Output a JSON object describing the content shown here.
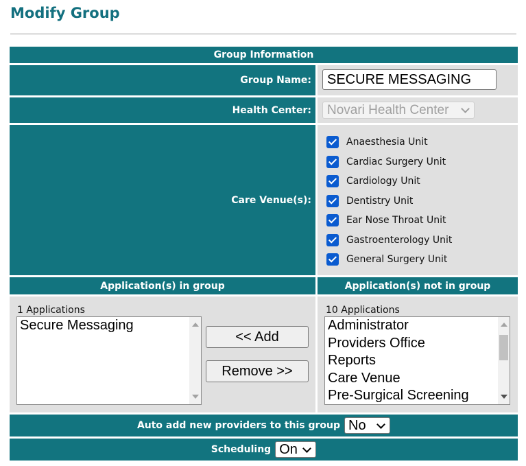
{
  "page": {
    "title": "Modify Group"
  },
  "group_info": {
    "header": "Group Information",
    "group_name_label": "Group Name:",
    "group_name_value": "SECURE MESSAGING",
    "health_center_label": "Health Center:",
    "health_center_value": "Novari Health Center",
    "care_venue_label": "Care Venue(s):",
    "care_venues": [
      {
        "label": "Anaesthesia Unit",
        "checked": true
      },
      {
        "label": "Cardiac Surgery Unit",
        "checked": true
      },
      {
        "label": "Cardiology Unit",
        "checked": true
      },
      {
        "label": "Dentistry Unit",
        "checked": true
      },
      {
        "label": "Ear Nose Throat Unit",
        "checked": true
      },
      {
        "label": "Gastroenterology Unit",
        "checked": true
      },
      {
        "label": "General Surgery Unit",
        "checked": true
      }
    ]
  },
  "applications": {
    "in_header": "Application(s) in group",
    "not_in_header": "Application(s) not in group",
    "in_count": "1 Applications",
    "not_in_count": "10 Applications",
    "in_items": [
      "Secure Messaging"
    ],
    "not_in_items": [
      "Administrator",
      "Providers Office",
      "Reports",
      "Care Venue",
      "Pre-Surgical Screening"
    ],
    "add_label": "<< Add",
    "remove_label": "Remove >>"
  },
  "auto_add": {
    "label": "Auto add new providers to this group",
    "value": "No"
  },
  "scheduling": {
    "label": "Scheduling",
    "value": "On"
  },
  "colors": {
    "header_teal": "#12747f",
    "title_teal": "#13707f",
    "row_grey": "#e0e0e0",
    "checkbox_blue": "#0a5bd0"
  }
}
